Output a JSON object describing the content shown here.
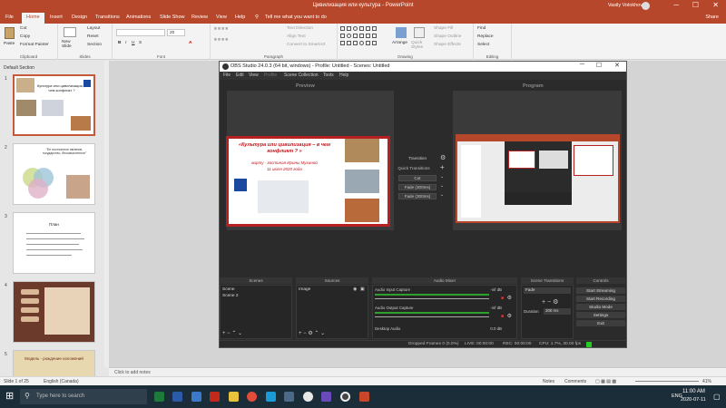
{
  "ppt": {
    "title": "Цивилизация или культура  -  PowerPoint",
    "user": "Vasily Volokhov",
    "window_controls": [
      "─",
      "☐",
      "✕"
    ],
    "tabs": [
      "File",
      "Home",
      "Insert",
      "Design",
      "Transitions",
      "Animations",
      "Slide Show",
      "Review",
      "View",
      "Help"
    ],
    "tell_me": "Tell me what you want to do",
    "share": "Share",
    "ribbon": {
      "paste": "Paste",
      "cut": "Cut",
      "copy": "Copy",
      "format_painter": "Format Painter",
      "new_slide": "New Slide",
      "layout": "Layout",
      "reset": "Reset",
      "section": "Section",
      "font_size": "20",
      "text_direction": "Text Direction",
      "align_text": "Align Text",
      "convert_smartart": "Convert to SmartArt",
      "arrange": "Arrange",
      "quick_styles": "Quick Styles",
      "shape_fill": "Shape Fill",
      "shape_outline": "Shape Outline",
      "shape_effects": "Shape Effects",
      "find": "Find",
      "replace": "Replace",
      "select": "Select",
      "groups": [
        "Clipboard",
        "Slides",
        "Font",
        "Paragraph",
        "Drawing",
        "Editing"
      ]
    },
    "section_label": "Default Section",
    "slide_numbers": [
      "1",
      "2",
      "3",
      "4",
      "5"
    ],
    "thumb1": {
      "title": "Культура или цивилизация, в чем конфликт ?"
    },
    "thumb2": {
      "text": "\"Ее постоянное явление, государство, бессмысленное\""
    },
    "thumb3": {
      "title": "План"
    },
    "thumb5": {
      "title": "Модель - рождение изложений"
    },
    "notes_placeholder": "Click to add notes",
    "status": {
      "slide": "Slide 1 of 25",
      "language": "English (Canada)",
      "notes": "Notes",
      "comments": "Comments",
      "zoom": "41%"
    }
  },
  "obs": {
    "title": "OBS Studio 24.0.3 (64 bit, windows) - Profile: Untitled - Scenes: Untitled",
    "menu": [
      "File",
      "Edit",
      "View",
      "Profile",
      "Scene Collection",
      "Tools",
      "Help"
    ],
    "window_controls": [
      "─",
      "☐",
      "✕"
    ],
    "preview_label": "Preview",
    "program_label": "Program",
    "transitions": [
      "Transition",
      "Quick Transitions",
      "Cut",
      "Fade (300ms)",
      "Fade (300ms)"
    ],
    "slide": {
      "title": "«Культура или цивилизация – в чем конфликт ? »",
      "subtitle": "вирту - гостиная Ирины Мухиной",
      "date": "11 июля 2020 года"
    },
    "docks": {
      "scenes": "Scenes",
      "sources": "Sources",
      "mixer": "Audio Mixer",
      "scene_transitions": "Scene Transitions",
      "controls": "Controls"
    },
    "scenes": [
      "Scene",
      "Scene 2"
    ],
    "sources": [
      "Image"
    ],
    "mixer_tracks": [
      {
        "name": "Audio Input Capture",
        "db": "-inf dB"
      },
      {
        "name": "Audio Output Capture",
        "db": "-inf dB"
      },
      {
        "name": "Desktop Audio",
        "db": "0.0 dB"
      }
    ],
    "scene_transition": {
      "type": "Fade",
      "duration_label": "Duration",
      "duration": "300 ms"
    },
    "controls": [
      "Start Streaming",
      "Start Recording",
      "Studio Mode",
      "Settings",
      "Exit"
    ],
    "status": {
      "dropped": "Dropped Frames 0 (0.0%)",
      "live": "LIVE: 00:00:00",
      "rec": "REC: 00:00:00",
      "cpu": "CPU: 1.7%, 30.00 fps"
    }
  },
  "taskbar": {
    "search_placeholder": "Type here to search",
    "time": "11:00 AM",
    "date": "2020-07-11",
    "lang": "ENG"
  }
}
